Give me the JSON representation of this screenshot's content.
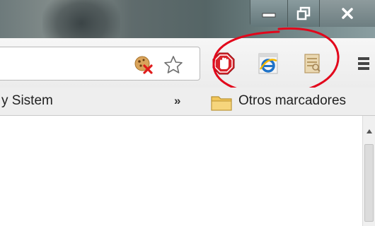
{
  "bookmarks_bar": {
    "truncated_item": "y Sistem",
    "overflow_chevron": "»",
    "other_bookmarks": "Otros marcadores"
  },
  "icons": {
    "window": [
      "minimize-icon",
      "maximize-icon",
      "close-icon"
    ],
    "omnibox": [
      "blocked-cookies-icon",
      "bookmark-star-icon"
    ],
    "extensions": [
      "adblock-stop-hand-icon",
      "internet-explorer-icon",
      "reader-document-icon",
      "chrome-menu-icon"
    ],
    "bookmarks": [
      "folder-icon"
    ]
  },
  "colors": {
    "annotation": "#e2061b",
    "adblock": "#d8232a",
    "ie": "#1f73c8",
    "folder": "#f1c65b"
  }
}
